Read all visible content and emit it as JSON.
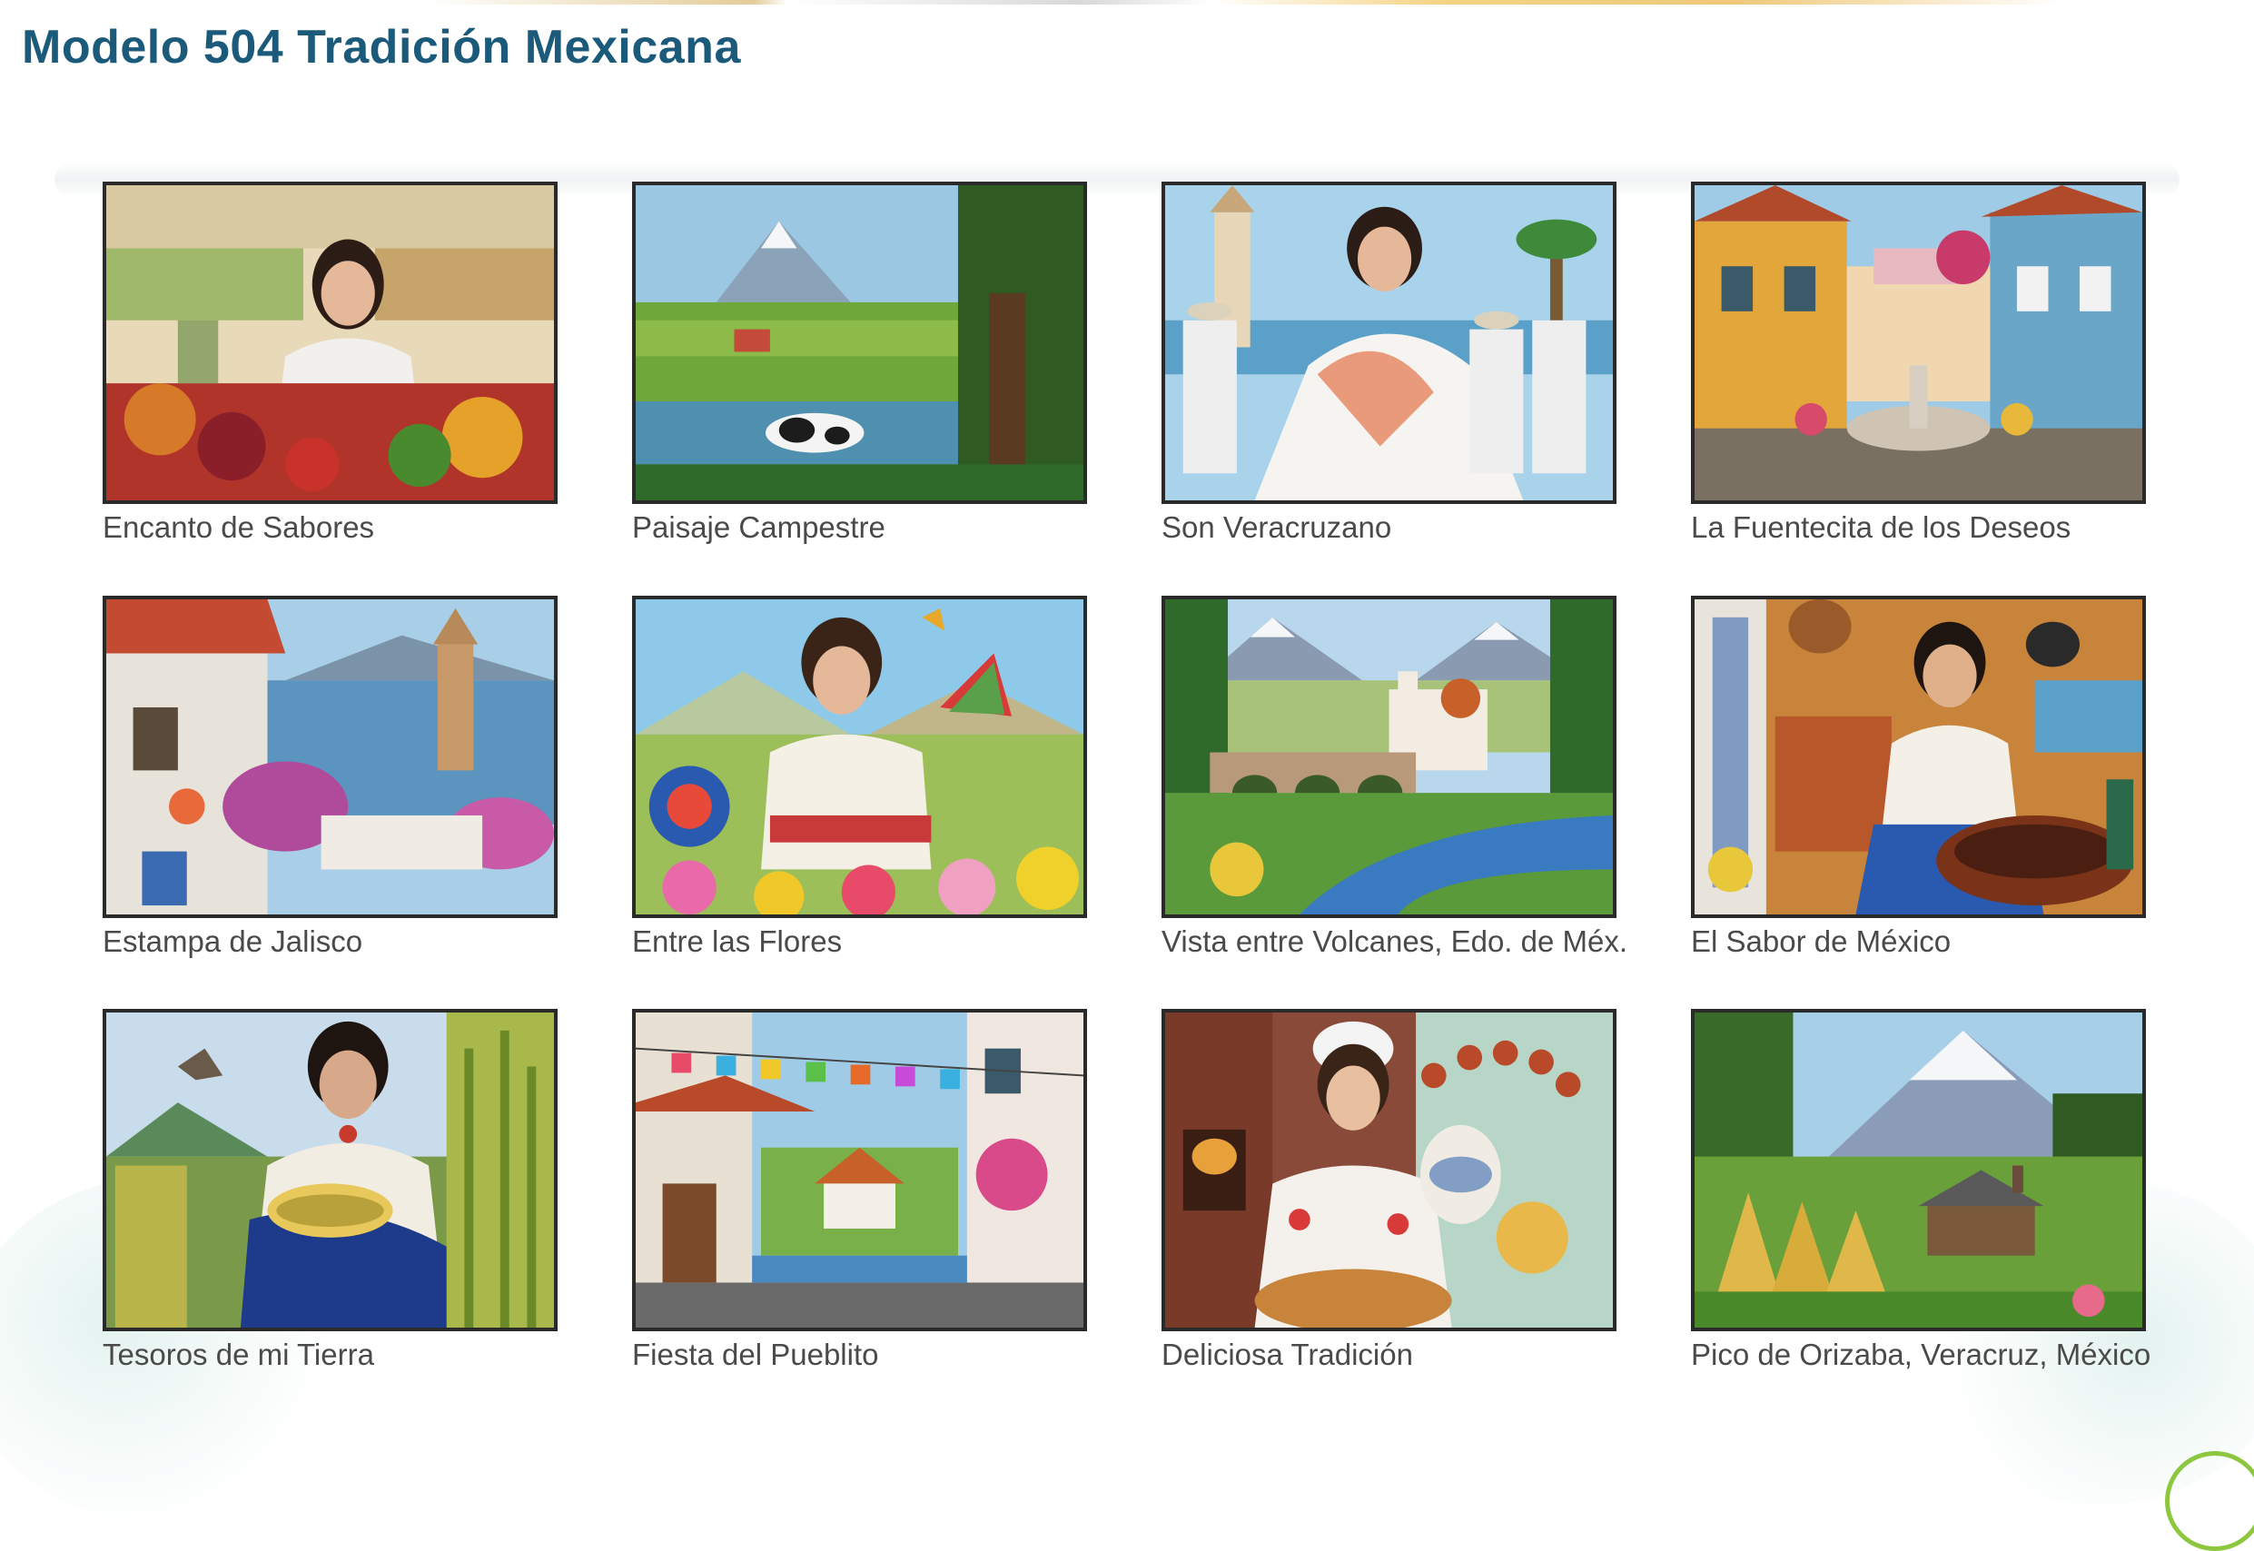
{
  "title": "Modelo 504 Tradición Mexicana",
  "paintings": [
    {
      "caption": "Encanto de Sabores"
    },
    {
      "caption": "Paisaje Campestre"
    },
    {
      "caption": "Son Veracruzano"
    },
    {
      "caption": "La Fuentecita de los Deseos"
    },
    {
      "caption": "Estampa de Jalisco"
    },
    {
      "caption": "Entre las Flores"
    },
    {
      "caption": "Vista entre Volcanes, Edo. de Méx."
    },
    {
      "caption": "El Sabor de México"
    },
    {
      "caption": "Tesoros de mi Tierra"
    },
    {
      "caption": "Fiesta del Pueblito"
    },
    {
      "caption": "Deliciosa Tradición"
    },
    {
      "caption": "Pico de Orizaba, Veracruz, México"
    }
  ]
}
